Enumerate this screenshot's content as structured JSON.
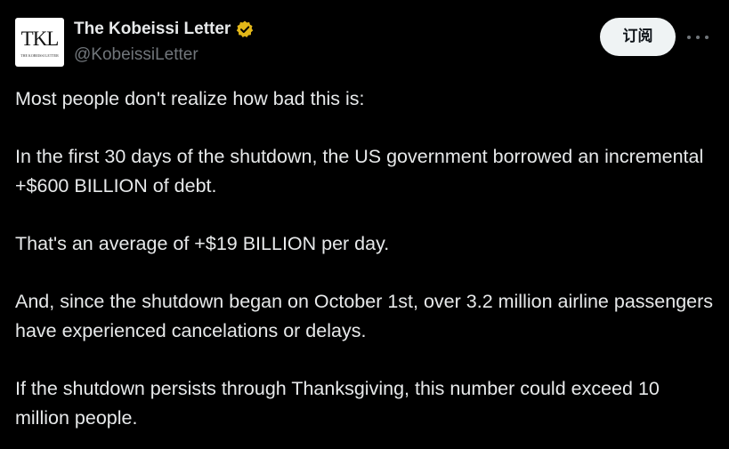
{
  "author": {
    "name": "The Kobeissi Letter",
    "handle": "@KobeissiLetter",
    "avatar_monogram": "TKL",
    "avatar_subtitle": "THE KOBEISSI LETTER",
    "verified_badge_color": "#e2b719"
  },
  "actions": {
    "subscribe_label": "订阅",
    "more_icon": "more-horizontal-icon"
  },
  "tweet": {
    "paragraphs": [
      "Most people don't realize how bad this is:",
      "In the first 30 days of the shutdown, the US government borrowed an incremental +$600 BILLION of debt.",
      "That's an average of +$19 BILLION per day.",
      "And, since the shutdown began on October 1st, over 3.2 million airline passengers have experienced cancelations or delays.",
      "If the shutdown persists through Thanksgiving, this number could exceed 10 million people."
    ]
  },
  "colors": {
    "background": "#000000",
    "text_primary": "#e7e9ea",
    "text_secondary": "#71767b",
    "button_bg": "#eff3f4"
  }
}
